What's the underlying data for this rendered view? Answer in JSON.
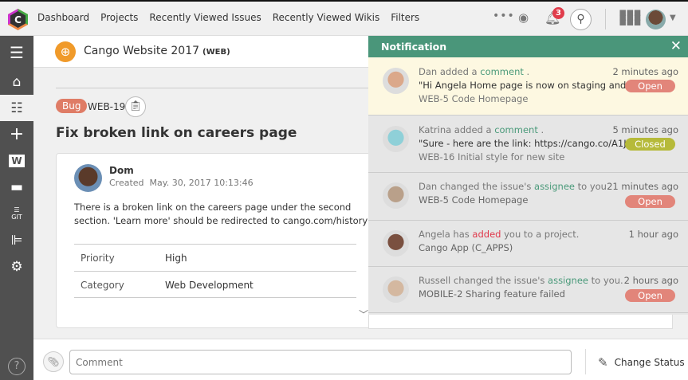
{
  "nav": {
    "items": [
      "Dashboard",
      "Projects",
      "Recently Viewed Issues",
      "Recently Viewed Wikis",
      "Filters"
    ],
    "notification_count": "3"
  },
  "project": {
    "name": "Cango Website 2017",
    "key": "(WEB)"
  },
  "issue": {
    "type": "Bug",
    "key": "WEB-19",
    "title": "Fix broken link on careers page",
    "author": "Dom",
    "created_label": "Created",
    "created": "May. 30, 2017 10:13:46",
    "description": "There is a broken link on the careers page under the second section. 'Learn more' should be redirected to cango.com/history",
    "fields": [
      {
        "label": "Priority",
        "value": "High"
      },
      {
        "label": "Category",
        "value": "Web Development"
      }
    ]
  },
  "comment": {
    "placeholder": "Comment",
    "change_status": "Change Status"
  },
  "notification": {
    "title": "Notification",
    "items": [
      {
        "user": "Dan",
        "pre": " added a ",
        "link": "comment",
        "post": " .",
        "line2": "\"Hi Angela Home page is now on staging and re...",
        "line3": "WEB-5 Code Homepage",
        "time": "2 minutes ago",
        "status": "Open",
        "color": "#dba88a"
      },
      {
        "user": "Katrina",
        "pre": " added a ",
        "link": "comment",
        "post": " .",
        "line2": "\"Sure - here are the link: https://cango.co/A1JYYj...",
        "line3": "WEB-16 Initial style for new site",
        "time": "5 minutes ago",
        "status": "Closed",
        "color": "#8fd0d8"
      },
      {
        "user": "Dan",
        "pre": " changed the issue's ",
        "link": "assignee",
        "post": "  to you.",
        "line2": "WEB-5 Code Homepage",
        "time": "21 minutes ago",
        "status": "Open",
        "color": "#b9a08a"
      },
      {
        "user": "Angela",
        "pre": "  has  ",
        "link": "added",
        "post": "  you to a project.",
        "line2": "Cango App (C_APPS)",
        "time": "1 hour ago",
        "status": "",
        "color": "#7a5040"
      },
      {
        "user": "Russell",
        "pre": "  changed the issue's ",
        "link": "assignee",
        "post": "  to you.",
        "line2": "MOBILE-2 Sharing feature failed",
        "time": "2 hours ago",
        "status": "Open",
        "color": "#d4b8a0"
      }
    ]
  },
  "colors": {
    "accent": "#4a967a",
    "open": "#e2857a",
    "closed": "#b6ba3a",
    "bug": "#df7c66",
    "sidebar": "#505050"
  }
}
